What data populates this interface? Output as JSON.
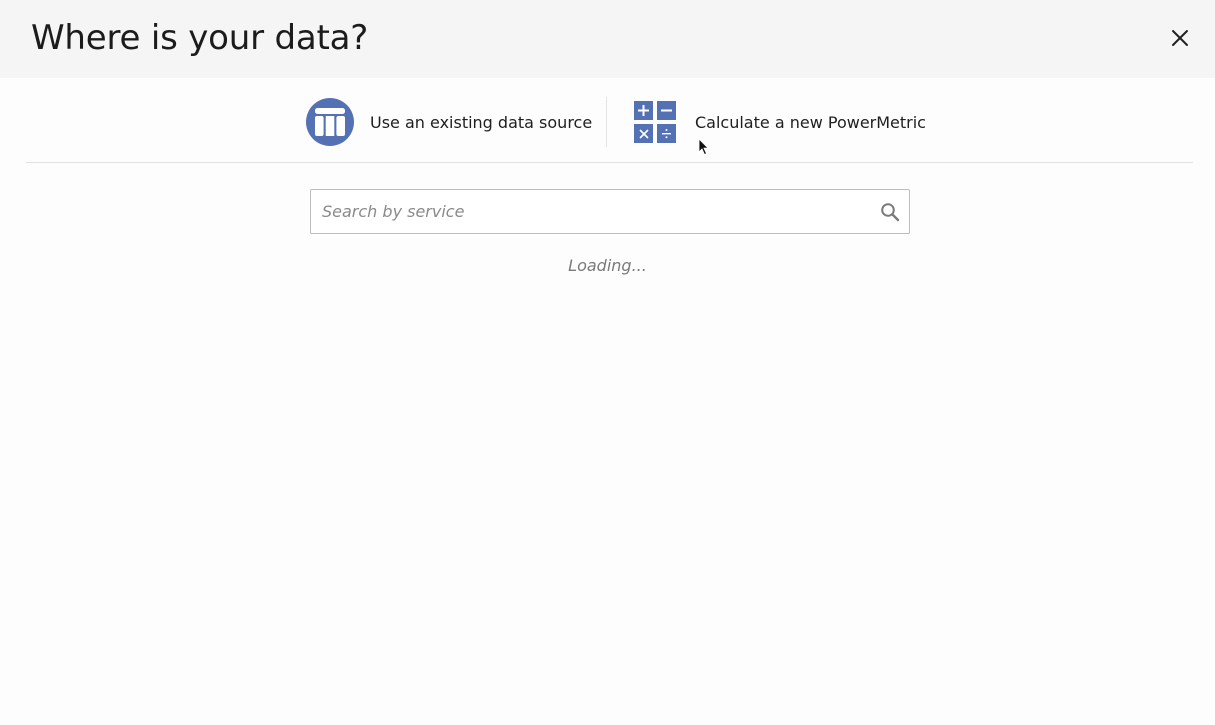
{
  "header": {
    "title": "Where is your data?",
    "close_icon": "close-icon"
  },
  "options": [
    {
      "label": "Use an existing data source",
      "icon": "data-table-icon"
    },
    {
      "label": "Calculate a new PowerMetric",
      "icon": "calculator-icon"
    }
  ],
  "search": {
    "value": "",
    "placeholder": "Search by service",
    "icon": "search-icon"
  },
  "status": {
    "loading_text": "Loading..."
  },
  "colors": {
    "accent": "#5471b3",
    "header_bg": "#f5f5f5",
    "page_bg": "#fdfdfd"
  }
}
